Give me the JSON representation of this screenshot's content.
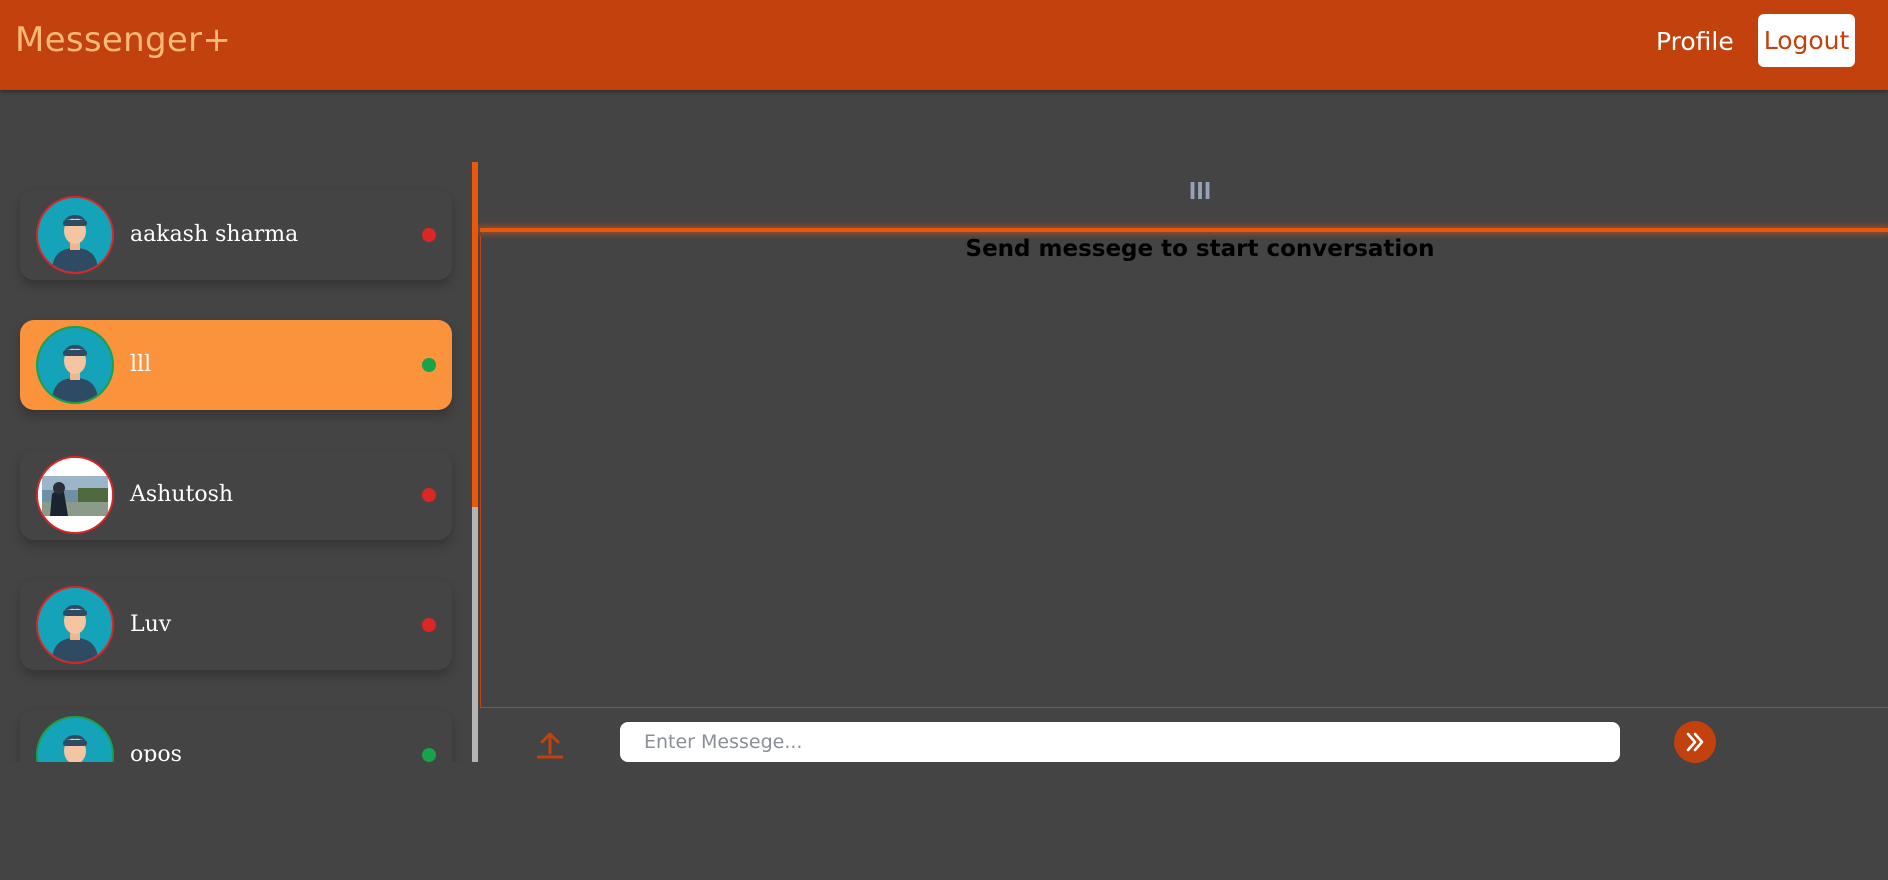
{
  "header": {
    "brand": "Messenger+",
    "profile_label": "Profile",
    "logout_label": "Logout"
  },
  "contacts": [
    {
      "name": "aakash sharma",
      "online": false,
      "active": false,
      "avatar": "default-avatar-icon"
    },
    {
      "name": "lll",
      "online": true,
      "active": true,
      "avatar": "default-avatar-icon"
    },
    {
      "name": "Ashutosh",
      "online": false,
      "active": false,
      "avatar": "photo-avatar"
    },
    {
      "name": "Luv",
      "online": false,
      "active": false,
      "avatar": "default-avatar-icon"
    },
    {
      "name": "opos",
      "online": true,
      "active": false,
      "avatar": "default-avatar-icon"
    }
  ],
  "chat": {
    "recipient_name": "lll",
    "empty_message": "Send messege to start conversation",
    "input_placeholder": "Enter Messege...",
    "input_value": ""
  },
  "colors": {
    "brand": "#c2410c",
    "accent": "#ea580c",
    "active_contact": "#fb923c",
    "online": "#16a34a",
    "offline": "#dc2626",
    "background": "#444444"
  },
  "icons": {
    "upload": "upload-icon",
    "send": "double-chevron-right-icon"
  }
}
